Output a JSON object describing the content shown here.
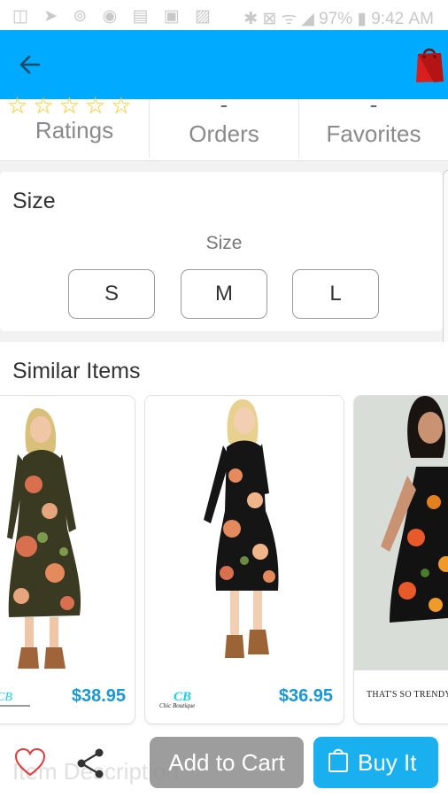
{
  "status_bar": {
    "battery": "97%",
    "time": "9:42 AM"
  },
  "app_bar": {
    "back_icon": "arrow-left-icon",
    "cart_icon": "shopping-bag-icon",
    "bar_color": "#00aaff"
  },
  "stats": {
    "rating_stars": 0,
    "rating_stars_max": 5,
    "ratings_label": "Ratings",
    "orders_value": "-",
    "orders_label": "Orders",
    "favorites_value": "-",
    "favorites_label": "Favorites"
  },
  "size_section": {
    "title": "Size",
    "subtitle": "Size",
    "options": [
      "S",
      "M",
      "L"
    ]
  },
  "similar_section": {
    "title": "Similar Items",
    "items": [
      {
        "price": "$38.95",
        "brand": "Chic Boutique",
        "logo": "CB"
      },
      {
        "price": "$36.95",
        "brand": "Chic Boutique",
        "logo": "CB"
      },
      {
        "price": "",
        "brand": "THAT'S SO TRENDY"
      }
    ]
  },
  "bottom_bar": {
    "faded_label": "Item Description",
    "add_to_cart": "Add to Cart",
    "buy_it": "Buy It"
  },
  "colors": {
    "accent": "#00aaff",
    "price": "#1a98d5",
    "buy_button": "#1ab0f0",
    "star": "#f5c518"
  }
}
